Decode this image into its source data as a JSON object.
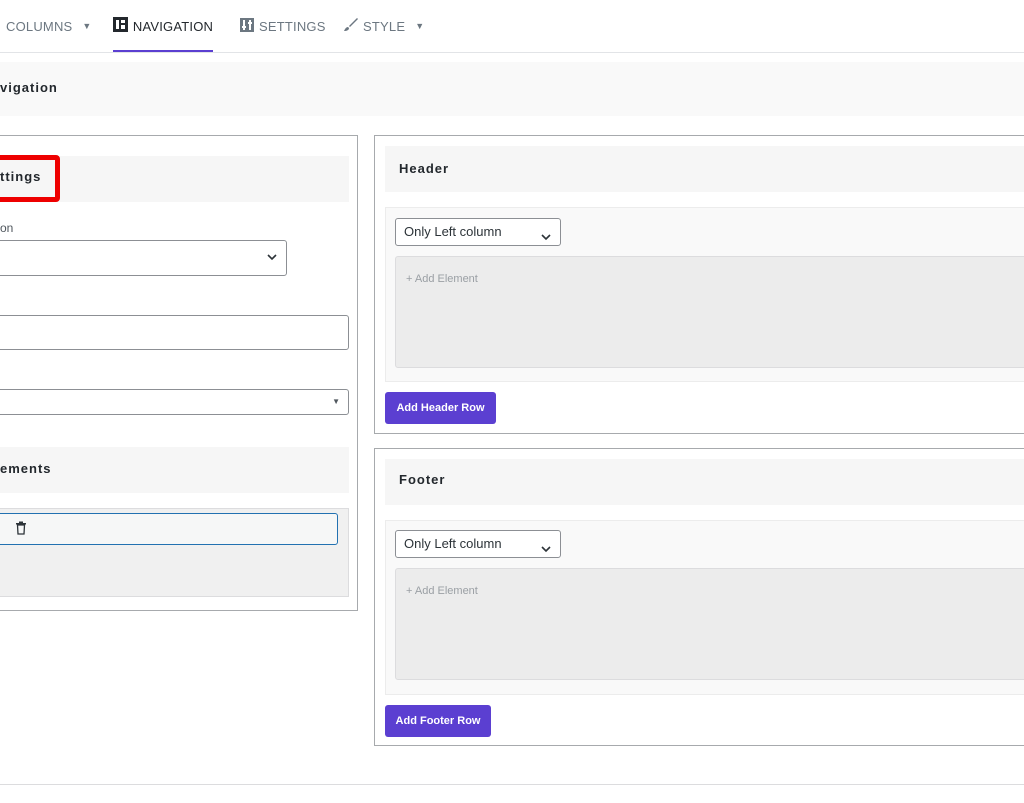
{
  "tabs": [
    {
      "label": "COLUMNS",
      "icon": "chevron-down-icon"
    },
    {
      "label": "NAVIGATION",
      "icon": "navigation-icon",
      "active": true
    },
    {
      "label": "SETTINGS",
      "icon": "sliders-icon"
    },
    {
      "label": "STYLE",
      "icon": "brush-icon"
    }
  ],
  "section": {
    "title": "vigation"
  },
  "left": {
    "settings_heading": "ttings",
    "field_label": "on",
    "elements_heading": "ements"
  },
  "header_panel": {
    "title": "Header",
    "column_select": "Only Left column",
    "add_element": "+ Add Element",
    "add_row_button": "Add Header Row"
  },
  "footer_panel": {
    "title": "Footer",
    "column_select": "Only Left column",
    "add_element": "+ Add Element",
    "add_row_button": "Add Footer Row"
  },
  "colors": {
    "accent": "#5b3fd1",
    "highlight": "#ee0000"
  }
}
